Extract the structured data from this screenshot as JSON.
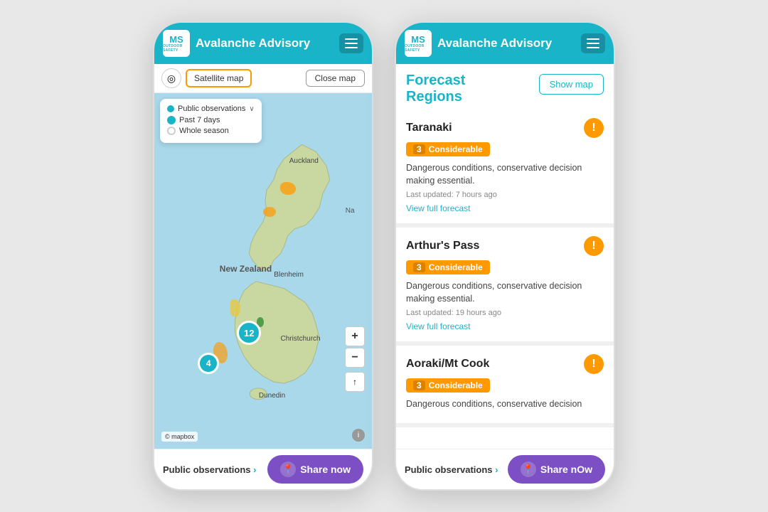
{
  "app": {
    "title": "Avalanche Advisory",
    "logo_text": "MS",
    "logo_sub": "OUTDOOR SAFETY"
  },
  "phone1": {
    "toolbar": {
      "satellite_btn": "Satellite map",
      "close_btn": "Close map"
    },
    "filter": {
      "public_obs": "Public observations",
      "past7": "Past 7 days",
      "whole_season": "Whole season"
    },
    "map_labels": {
      "auckland": "Auckland",
      "nz": "New Zealand",
      "blenheim": "Blenheim",
      "christchurch": "Christchurch",
      "dunedin": "Dunedin",
      "na": "Na"
    },
    "clusters": {
      "twelve": "12",
      "four": "4"
    },
    "footer": {
      "public_obs": "Public observations",
      "arrow": "›",
      "share": "Share now"
    },
    "mapbox": "© mapbox"
  },
  "phone2": {
    "header": {
      "forecast_title": "Forecast\nRegions",
      "show_map": "Show map"
    },
    "regions": [
      {
        "name": "Taranaki",
        "badge_num": "3",
        "badge_label": "Considerable",
        "description": "Dangerous conditions, conservative decision making essential.",
        "updated": "Last updated: 7 hours ago",
        "view_link": "View full forecast"
      },
      {
        "name": "Arthur's Pass",
        "badge_num": "3",
        "badge_label": "Considerable",
        "description": "Dangerous conditions, conservative decision making essential.",
        "updated": "Last updated: 19 hours ago",
        "view_link": "View full forecast"
      },
      {
        "name": "Aoraki/Mt Cook",
        "badge_num": "3",
        "badge_label": "Considerable",
        "description": "Dangerous conditions, conservative decision",
        "updated": "",
        "view_link": ""
      }
    ],
    "footer": {
      "public_obs": "Public observations",
      "arrow": "›",
      "share": "Share nOw"
    }
  },
  "icons": {
    "menu": "☰",
    "location": "◎",
    "warning": "!",
    "share": "📍",
    "zoom_in": "+",
    "zoom_out": "−",
    "compass": "↑",
    "info": "i",
    "chevron_down": "∨"
  }
}
